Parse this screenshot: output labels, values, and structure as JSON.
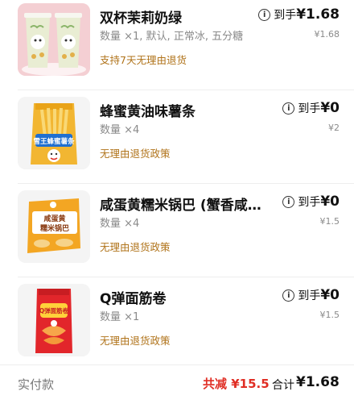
{
  "items": [
    {
      "title": "双杯茉莉奶绿",
      "meta": "数量 ×1, 默认, 正常冰, 五分糖",
      "policy": "支持7天无理由退货",
      "price_label": "到手",
      "price": "¥1.68",
      "original_price": "¥1.68",
      "image_icon": "milk-tea-cups-icon"
    },
    {
      "title": "蜂蜜黄油味薯条",
      "meta": "数量 ×4",
      "policy": "无理由退货政策",
      "price_label": "到手",
      "price": "¥0",
      "original_price": "¥2",
      "image_icon": "fries-snack-bag-icon",
      "bag_text": "雪王蜂蜜薯条"
    },
    {
      "title": "咸蛋黄糯米锅巴 (蟹香咸蛋黄…",
      "meta": "数量 ×4",
      "policy": "无理由退货政策",
      "price_label": "到手",
      "price": "¥0",
      "original_price": "¥1.5",
      "image_icon": "rice-crisp-bag-icon",
      "bag_text_1": "咸蛋黄",
      "bag_text_2": "糯米锅巴"
    },
    {
      "title": "Q弹面筋卷",
      "meta": "数量 ×1",
      "policy": "无理由退货政策",
      "price_label": "到手",
      "price": "¥0",
      "original_price": "¥1.5",
      "image_icon": "gluten-roll-bag-icon",
      "bag_text": "Q弹面筋卷"
    }
  ],
  "footer": {
    "paid_label": "实付款",
    "discount": "共减 ¥15.5",
    "total_label": "合计",
    "total_amount": "¥1.68"
  },
  "colors": {
    "accent_red": "#e02e24",
    "policy_gold": "#b0731a",
    "muted": "#8a8a8a"
  }
}
